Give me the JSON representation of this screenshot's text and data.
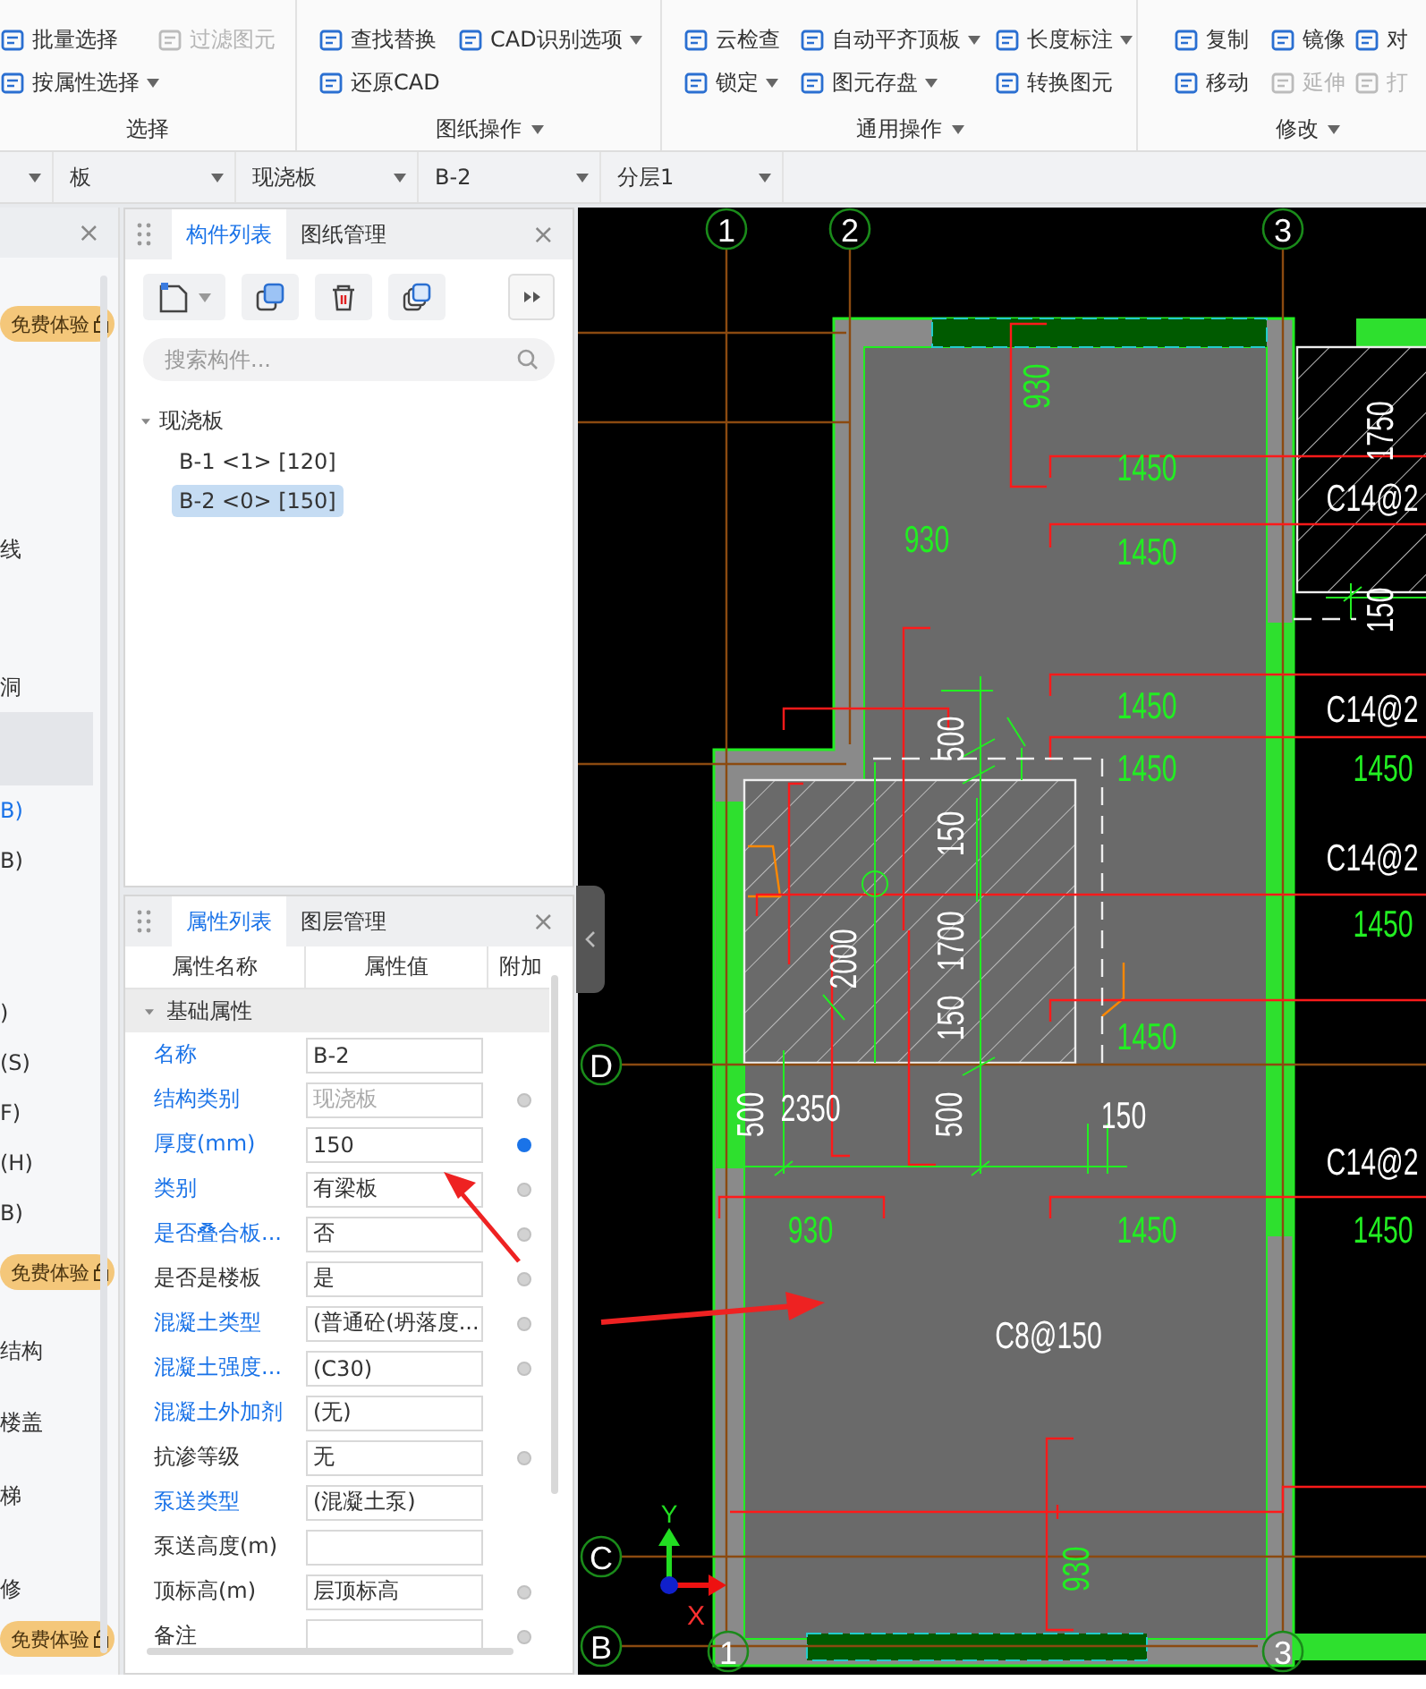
{
  "ribbon": {
    "groups": [
      {
        "label": "选择",
        "menu": false,
        "columns": [
          [
            {
              "label": "批量选择",
              "disabled": false,
              "dropdown": false
            },
            {
              "label": "按属性选择",
              "disabled": false,
              "dropdown": true
            }
          ],
          [
            {
              "label": "过滤图元",
              "disabled": true,
              "dropdown": false
            }
          ]
        ]
      },
      {
        "label": "图纸操作",
        "menu": true,
        "columns": [
          [
            {
              "label": "查找替换",
              "disabled": false,
              "dropdown": false
            },
            {
              "label": "还原CAD",
              "disabled": false,
              "dropdown": false
            }
          ],
          [
            {
              "label": "CAD识别选项",
              "disabled": false,
              "dropdown": true
            }
          ]
        ]
      },
      {
        "label": "通用操作",
        "menu": true,
        "columns": [
          [
            {
              "label": "云检查",
              "disabled": false,
              "dropdown": false
            },
            {
              "label": "锁定",
              "disabled": false,
              "dropdown": true
            }
          ],
          [
            {
              "label": "自动平齐顶板",
              "disabled": false,
              "dropdown": true
            },
            {
              "label": "图元存盘",
              "disabled": false,
              "dropdown": true
            }
          ],
          [
            {
              "label": "长度标注",
              "disabled": false,
              "dropdown": true
            },
            {
              "label": "转换图元",
              "disabled": false,
              "dropdown": false
            }
          ]
        ]
      },
      {
        "label": "修改",
        "menu": true,
        "columns": [
          [
            {
              "label": "复制",
              "disabled": false,
              "dropdown": false
            },
            {
              "label": "移动",
              "disabled": false,
              "dropdown": false
            }
          ],
          [
            {
              "label": "镜像",
              "disabled": false,
              "dropdown": false
            },
            {
              "label": "延伸",
              "disabled": true,
              "dropdown": false
            }
          ],
          [
            {
              "label": "对",
              "disabled": false,
              "dropdown": false
            },
            {
              "label": "打",
              "disabled": true,
              "dropdown": false
            }
          ]
        ]
      }
    ]
  },
  "filter_bar": [
    {
      "kind": "dropdown"
    },
    {
      "kind": "dropdown",
      "value": "板"
    },
    {
      "kind": "dropdown",
      "value": "现浇板"
    },
    {
      "kind": "dropdown",
      "value": "B-2"
    },
    {
      "kind": "dropdown",
      "value": "分层1"
    }
  ],
  "left_panel": {
    "close": "×",
    "items": [
      {
        "kind": "badge",
        "badge": "免费体验"
      },
      {
        "kind": "item",
        "text": "线",
        "selected": false,
        "active": false
      },
      {
        "kind": "item",
        "text": "洞",
        "selected": false,
        "active": false
      },
      {
        "kind": "item",
        "selected": true,
        "active": false
      },
      {
        "kind": "item",
        "text": "B)",
        "selected": false,
        "active": true
      },
      {
        "kind": "item",
        "text": "B)",
        "selected": false,
        "active": false
      },
      {
        "kind": "item",
        "text": ")",
        "selected": false,
        "active": false
      },
      {
        "kind": "item",
        "text": "(S)",
        "selected": false,
        "active": false
      },
      {
        "kind": "item",
        "text": "F)",
        "selected": false,
        "active": false
      },
      {
        "kind": "item",
        "text": "(H)",
        "selected": false,
        "active": false
      },
      {
        "kind": "item",
        "text": "B)",
        "selected": false,
        "active": false
      },
      {
        "kind": "badge",
        "badge": "免费体验"
      },
      {
        "kind": "item",
        "text": "结构",
        "selected": false,
        "active": false
      },
      {
        "kind": "item",
        "text": "楼盖",
        "selected": false,
        "active": false
      },
      {
        "kind": "item",
        "text": "梯",
        "selected": false,
        "active": false
      },
      {
        "kind": "item",
        "text": "修",
        "selected": false,
        "active": false
      },
      {
        "kind": "badge",
        "badge": "免费体验"
      }
    ]
  },
  "component_panel": {
    "tabs": [
      {
        "label": "构件列表",
        "selected": true
      },
      {
        "label": "图纸管理",
        "selected": false
      }
    ],
    "close": "×",
    "search": {
      "placeholder": "搜索构件..."
    },
    "tree": [
      {
        "label": "现浇板",
        "expanded": true,
        "children": [
          {
            "label": "B-1 <1> [120]",
            "selected": false
          },
          {
            "label": "B-2 <0> [150]",
            "selected": true
          }
        ]
      }
    ]
  },
  "properties_panel": {
    "tabs": [
      {
        "label": "属性列表",
        "selected": true
      },
      {
        "label": "图层管理",
        "selected": false
      }
    ],
    "close": "×",
    "columns": [
      "属性名称",
      "属性值",
      "附加"
    ],
    "group": {
      "label": "基础属性",
      "expanded": true
    },
    "rows": [
      {
        "name": "名称",
        "value": "B-2",
        "public": true,
        "locked": false
      },
      {
        "name": "结构类别",
        "value": "现浇板",
        "public": true,
        "locked": true,
        "attached": false
      },
      {
        "name": "厚度(mm)",
        "value": "150",
        "public": true,
        "locked": false,
        "attached": true
      },
      {
        "name": "类别",
        "value": "有梁板",
        "public": true,
        "locked": false,
        "attached": false
      },
      {
        "name": "是否叠合板...",
        "value": "否",
        "public": true,
        "locked": false,
        "attached": false
      },
      {
        "name": "是否是楼板",
        "value": "是",
        "public": false,
        "locked": false,
        "attached": false
      },
      {
        "name": "混凝土类型",
        "value": "(普通砼(坍落度...",
        "public": true,
        "locked": false,
        "attached": false
      },
      {
        "name": "混凝土强度...",
        "value": "(C30)",
        "public": true,
        "locked": false,
        "attached": false
      },
      {
        "name": "混凝土外加剂",
        "value": "(无)",
        "public": true,
        "locked": false
      },
      {
        "name": "抗渗等级",
        "value": "无",
        "public": false,
        "locked": false,
        "attached": false
      },
      {
        "name": "泵送类型",
        "value": "(混凝土泵)",
        "public": true,
        "locked": false
      },
      {
        "name": "泵送高度(m)",
        "public": false,
        "locked": false
      },
      {
        "name": "顶标高(m)",
        "value": "层顶标高",
        "public": false,
        "locked": false,
        "attached": false
      },
      {
        "name": "备注",
        "public": false,
        "locked": false,
        "attached": false
      }
    ]
  },
  "drawing": {
    "axis_bubbles": [
      {
        "label": "1"
      },
      {
        "label": "2"
      },
      {
        "label": "3"
      },
      {
        "label": "D"
      },
      {
        "label": "C"
      },
      {
        "label": "B"
      },
      {
        "label": "1"
      },
      {
        "label": "3"
      }
    ],
    "labels": [
      {
        "text": "930",
        "color": "#22ee22"
      },
      {
        "text": "1750",
        "color": "#ffffff"
      },
      {
        "text": "1450",
        "color": "#22ee22"
      },
      {
        "text": "C14@2",
        "color": "#ffffff"
      },
      {
        "text": "930",
        "color": "#22ee22"
      },
      {
        "text": "1450",
        "color": "#22ee22"
      },
      {
        "text": "150",
        "color": "#ffffff"
      },
      {
        "text": "1450",
        "color": "#22ee22"
      },
      {
        "text": "C14@2",
        "color": "#ffffff"
      },
      {
        "text": "500",
        "color": "#ffffff"
      },
      {
        "text": "1450",
        "color": "#22ee22"
      },
      {
        "text": "1450",
        "color": "#22ee22"
      },
      {
        "text": "150",
        "color": "#ffffff"
      },
      {
        "text": "C14@2",
        "color": "#ffffff"
      },
      {
        "text": "1450",
        "color": "#22ee22"
      },
      {
        "text": "1700",
        "color": "#ffffff"
      },
      {
        "text": "2000",
        "color": "#ffffff"
      },
      {
        "text": "150",
        "color": "#ffffff"
      },
      {
        "text": "1450",
        "color": "#22ee22"
      },
      {
        "text": "500",
        "color": "#ffffff"
      },
      {
        "text": "2350",
        "color": "#ffffff"
      },
      {
        "text": "500",
        "color": "#ffffff"
      },
      {
        "text": "150",
        "color": "#ffffff"
      },
      {
        "text": "C14@2",
        "color": "#ffffff"
      },
      {
        "text": "930",
        "color": "#22ee22"
      },
      {
        "text": "1450",
        "color": "#22ee22"
      },
      {
        "text": "1450",
        "color": "#22ee22"
      },
      {
        "text": "C8@150",
        "color": "#ffffff"
      },
      {
        "text": "930",
        "color": "#22ee22"
      }
    ],
    "ucs": {
      "y": "Y",
      "x": "X"
    }
  }
}
